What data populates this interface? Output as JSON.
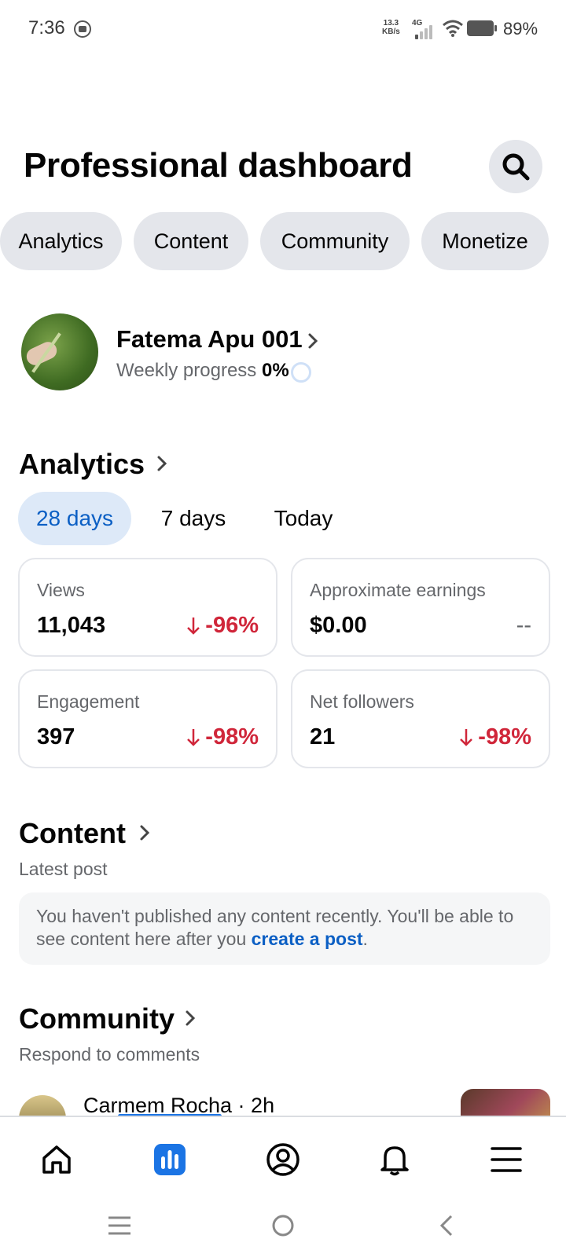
{
  "status_bar": {
    "time": "7:36",
    "net_speed_value": "13.3",
    "net_speed_unit": "KB/s",
    "network_type": "4G",
    "battery_percent": "89%"
  },
  "header": {
    "title": "Professional dashboard",
    "search_icon": "search-icon"
  },
  "tabs": [
    {
      "label": "Analytics"
    },
    {
      "label": "Content"
    },
    {
      "label": "Community"
    },
    {
      "label": "Monetize"
    }
  ],
  "profile": {
    "name": "Fatema Apu 001",
    "weekly_label": "Weekly progress",
    "weekly_value": "0%",
    "weekly_progress_fraction": 0
  },
  "analytics": {
    "title": "Analytics",
    "periods": [
      {
        "label": "28 days",
        "active": true
      },
      {
        "label": "7 days",
        "active": false
      },
      {
        "label": "Today",
        "active": false
      }
    ],
    "metrics": [
      {
        "label": "Views",
        "value": "11,043",
        "change": "-96%",
        "direction": "down"
      },
      {
        "label": "Approximate earnings",
        "value": "$0.00",
        "change": "--",
        "direction": "none"
      },
      {
        "label": "Engagement",
        "value": "397",
        "change": "-98%",
        "direction": "down"
      },
      {
        "label": "Net followers",
        "value": "21",
        "change": "-98%",
        "direction": "down"
      }
    ]
  },
  "content": {
    "title": "Content",
    "subtitle": "Latest post",
    "notice_text": "You haven't published any content recently. You'll be able to see content here after you ",
    "notice_link": "create a post",
    "notice_end": "."
  },
  "community": {
    "title": "Community",
    "subtitle": "Respond to comments",
    "comment_author": "Carmem Rocha · 2h"
  },
  "bottom_nav": [
    {
      "icon": "home-icon"
    },
    {
      "icon": "dashboard-icon",
      "active": true
    },
    {
      "icon": "profile-icon"
    },
    {
      "icon": "bell-icon"
    },
    {
      "icon": "menu-icon"
    }
  ],
  "colors": {
    "accent": "#1b74e4",
    "negative": "#d0263a",
    "pill_bg": "#e4e6eb"
  }
}
